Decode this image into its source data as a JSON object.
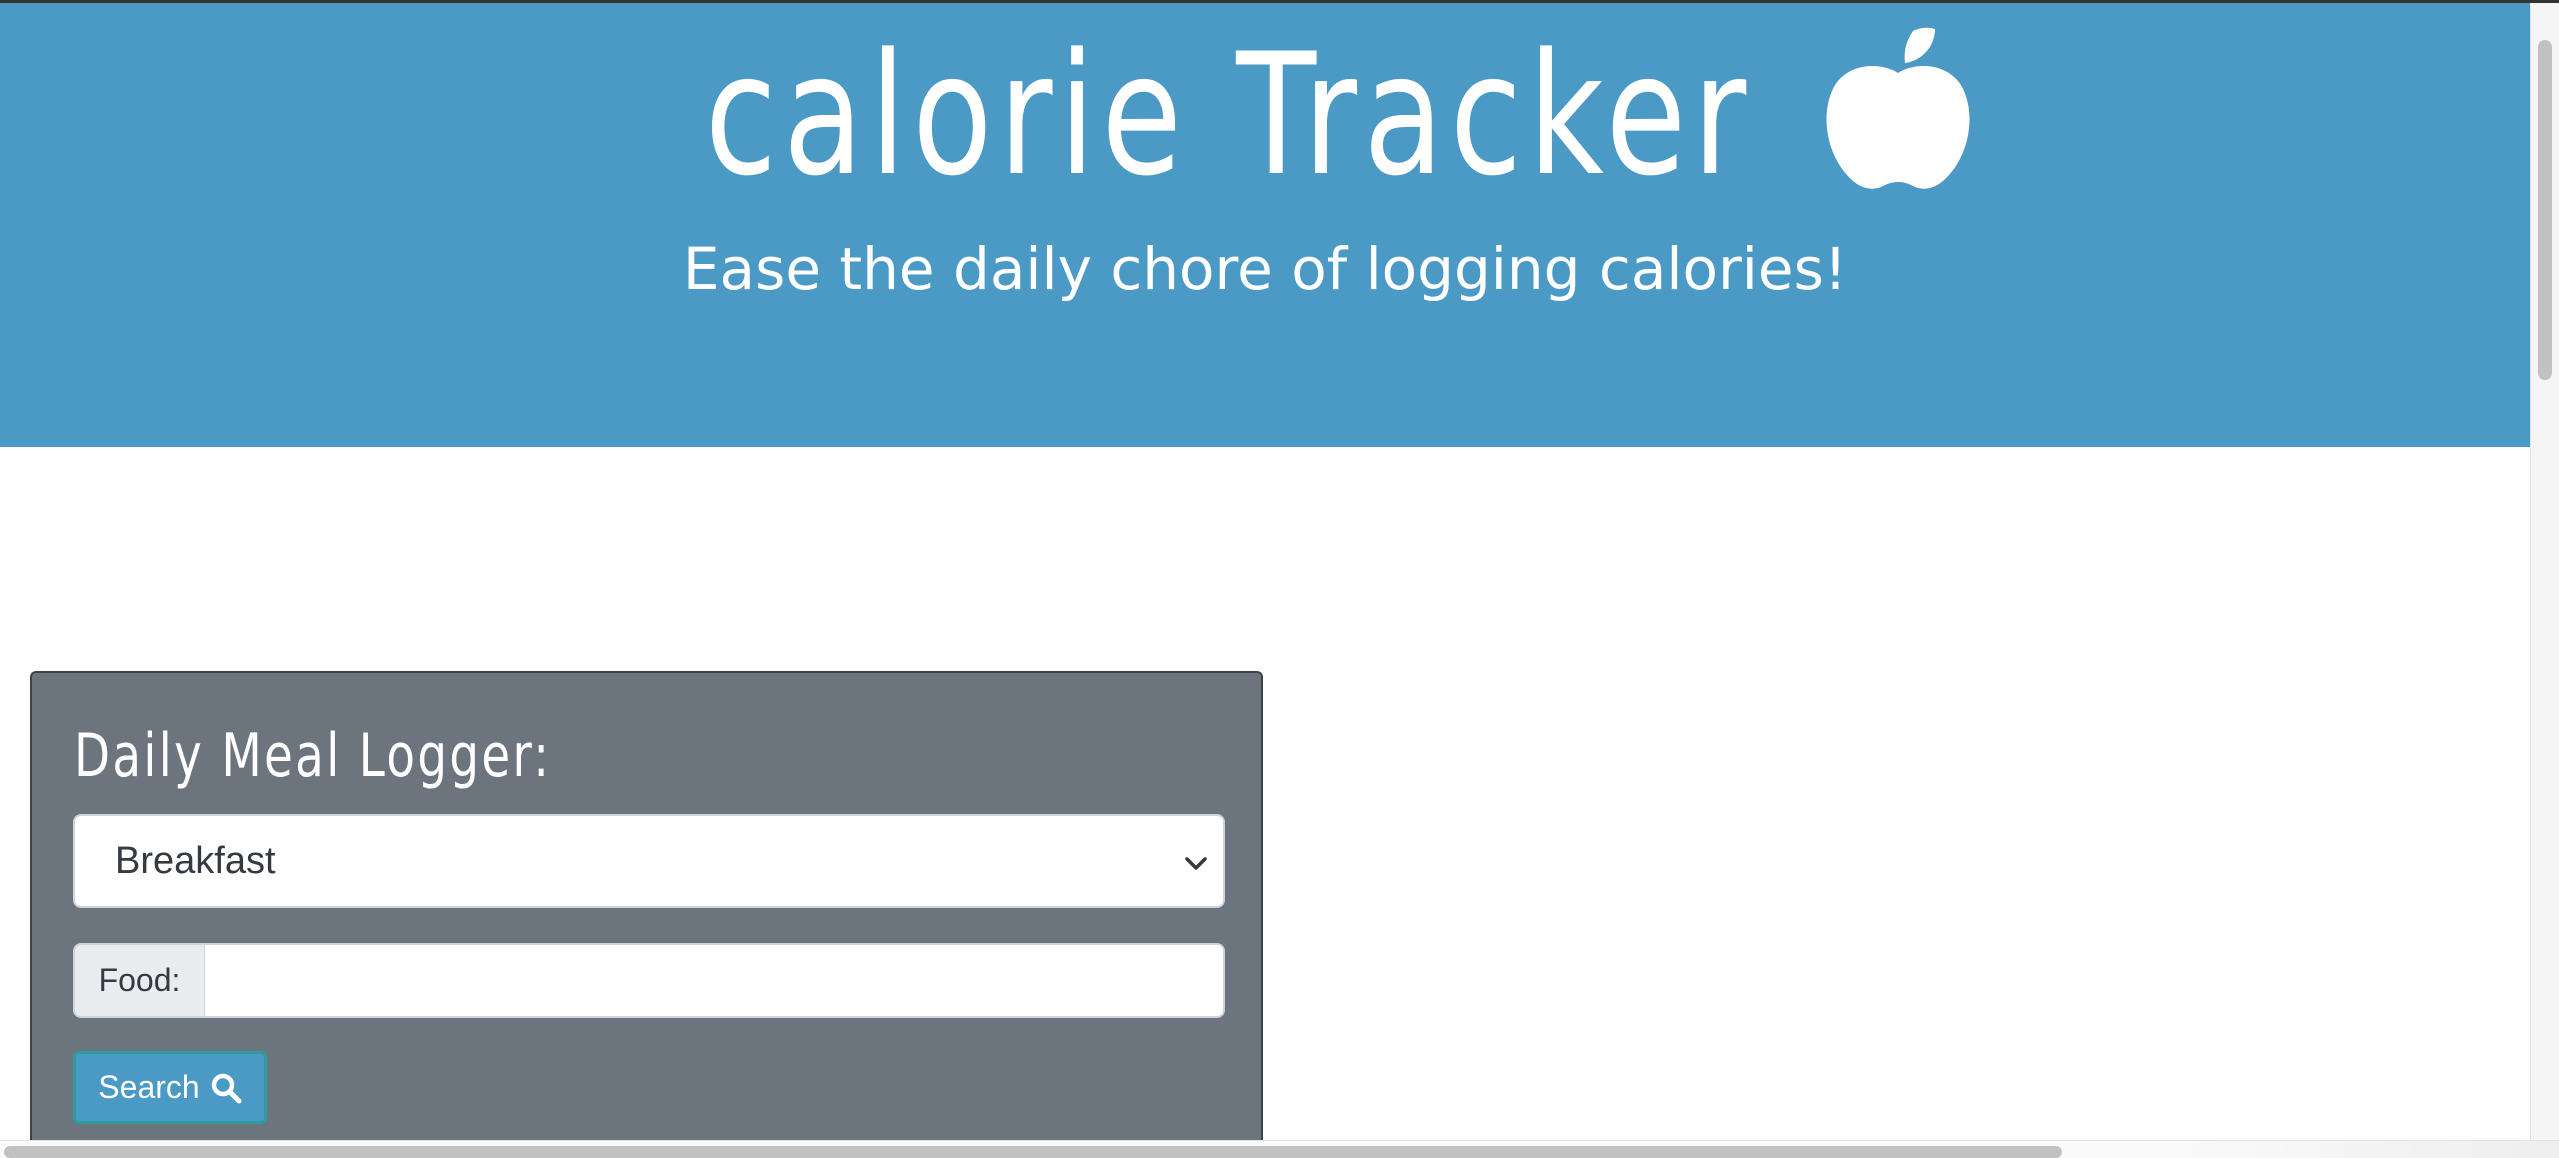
{
  "header": {
    "title": "calorie Tracker",
    "tagline": "Ease the daily chore of logging calories!",
    "icon": "apple-icon"
  },
  "logger": {
    "title": "Daily Meal Logger:",
    "meal_select": {
      "value": "Breakfast"
    },
    "food_label": "Food:",
    "food_input": {
      "value": "",
      "placeholder": ""
    },
    "search_label": "Search",
    "search_icon": "search-icon"
  },
  "colors": {
    "hero_bg": "#4b9ac6",
    "card_bg": "#6c757d",
    "button_bg": "#4b9ac6"
  }
}
